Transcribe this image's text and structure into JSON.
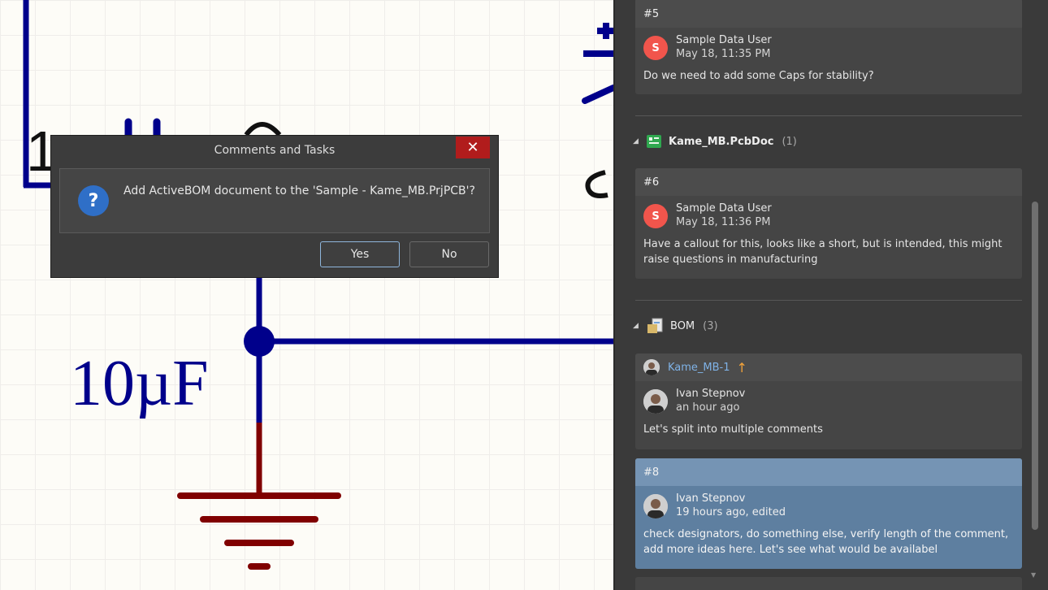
{
  "canvas": {
    "pin_label_left": "1",
    "pin_label_right": "2",
    "value_label": "10µF",
    "colors": {
      "wire": "#00008b",
      "ground": "#800000",
      "grid": "#efedea",
      "background": "#fdfcf7"
    }
  },
  "dialog": {
    "title": "Comments and Tasks",
    "close_icon": "close-icon",
    "message": "Add ActiveBOM document to the 'Sample - Kame_MB.PrjPCB'?",
    "question_icon": "?",
    "yes_label": "Yes",
    "no_label": "No"
  },
  "panel": {
    "cards": [
      {
        "id": "#5",
        "user": "Sample Data User",
        "avatar_initial": "S",
        "time": "May 18, 11:35 PM",
        "text": "Do we need to add some Caps for stability?"
      },
      {
        "id": "#6",
        "user": "Sample Data User",
        "avatar_initial": "S",
        "time": "May 18, 11:36 PM",
        "text": "Have a callout for this, looks like a short, but is intended, this might raise questions in manufacturing"
      },
      {
        "id": "Kame_MB-1",
        "user": "Ivan Stepnov",
        "time": "an hour ago",
        "text": "Let's split into multiple comments"
      },
      {
        "id": "#8",
        "user": "Ivan Stepnov",
        "time": "19 hours ago, edited",
        "text": "check designators, do something else, verify length of the comment, add more ideas here. Let's see what would be availabel"
      }
    ],
    "groups": [
      {
        "name": "Kame_MB.PcbDoc",
        "count": "(1)",
        "icon": "pcb-document-icon"
      },
      {
        "name": "BOM",
        "count": "(3)",
        "icon": "bom-document-icon"
      }
    ],
    "colors": {
      "accent_link": "#7fb2e6",
      "arrow": "#f2a33a",
      "selected": "#5e7fa0",
      "avatar_red": "#f1554c"
    }
  }
}
